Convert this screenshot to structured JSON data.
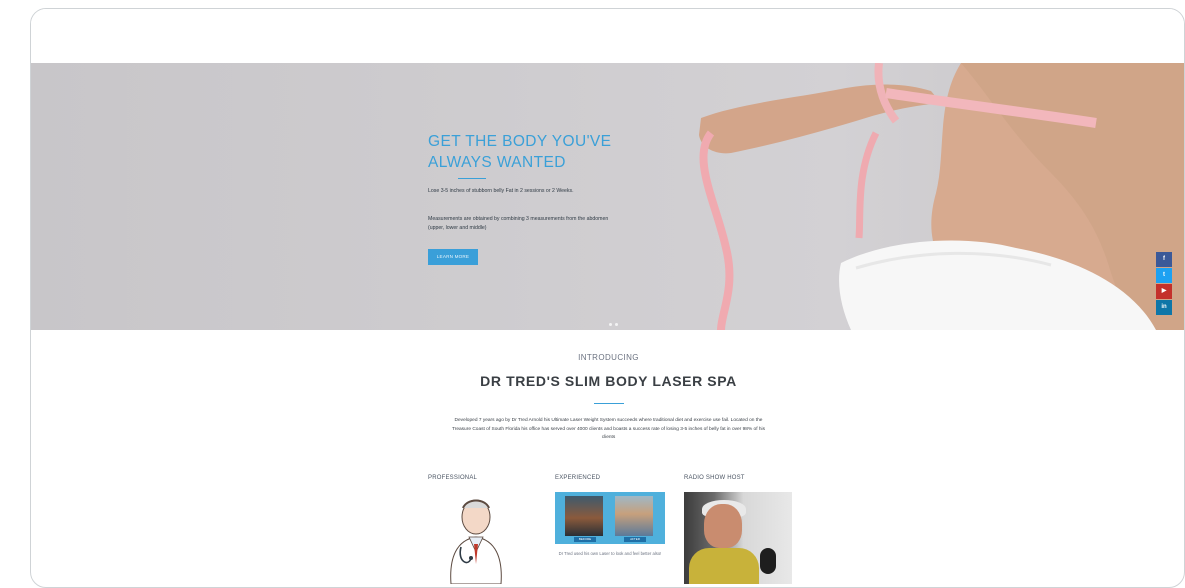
{
  "hero": {
    "title": "GET THE BODY YOU'VE ALWAYS WANTED",
    "text1": "Lose 3-5 inches of stubborn belly Fat in 2 sessions or 2 Weeks.",
    "text2": "Measurements are obtained by combining 3 measurements from the abdomen (upper, lower and middle)",
    "button": "LEARN MORE"
  },
  "social": {
    "facebook": "f",
    "twitter": "t",
    "youtube": "▶",
    "linkedin": "in"
  },
  "intro": {
    "label": "INTRODUCING",
    "title": "DR TRED'S SLIM BODY LASER SPA",
    "description": "Developed 7 years ago by Dr Tred Arnold his Ultimate Laser Weight System succeeds where traditional diet and exercise use fail. Located on the Treasure Coast of South Florida his office has served over 4000 clients and boasts a success rate of losing 3-5 inches of belly fat in over 98% of his clients"
  },
  "columns": {
    "professional": "PROFESSIONAL",
    "experienced": "EXPERIENCED",
    "radio": "RADIO SHOW HOST"
  },
  "experienced": {
    "tag1": "BEFORE",
    "tag2": "AFTER",
    "caption": "Dr Tred used his own Laser to look and feel better also!"
  },
  "colors": {
    "accent": "#3aa0d8",
    "facebook": "#3b5998",
    "twitter": "#1da1f2",
    "youtube": "#c4302b",
    "linkedin": "#0e76a8"
  }
}
